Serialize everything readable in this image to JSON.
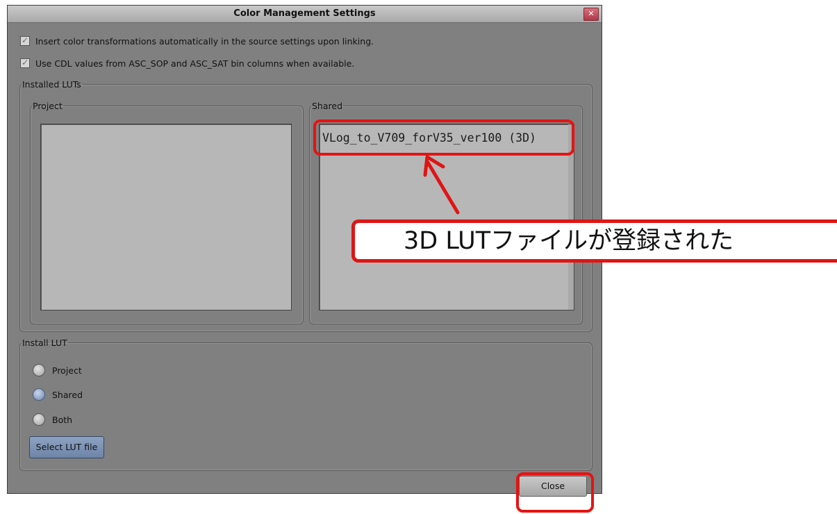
{
  "dialog": {
    "title": "Color Management Settings",
    "close_glyph": "✕"
  },
  "options": {
    "insert_transforms_label": "Insert color transformations automatically in the source settings upon linking.",
    "use_cdl_label": "Use CDL values from ASC_SOP and ASC_SAT bin columns when available."
  },
  "installed_luts": {
    "legend": "Installed LUTs",
    "project_legend": "Project",
    "shared_legend": "Shared",
    "shared_items": [
      "VLog_to_V709_forV35_ver100 (3D)"
    ]
  },
  "install_lut": {
    "legend": "Install LUT",
    "radio_project": "Project",
    "radio_shared": "Shared",
    "radio_both": "Both",
    "selected": "Shared",
    "select_button": "Select LUT file"
  },
  "close_button": "Close",
  "annotation": {
    "callout_text": "3D LUTファイルが登録された",
    "color": "#e01414"
  }
}
